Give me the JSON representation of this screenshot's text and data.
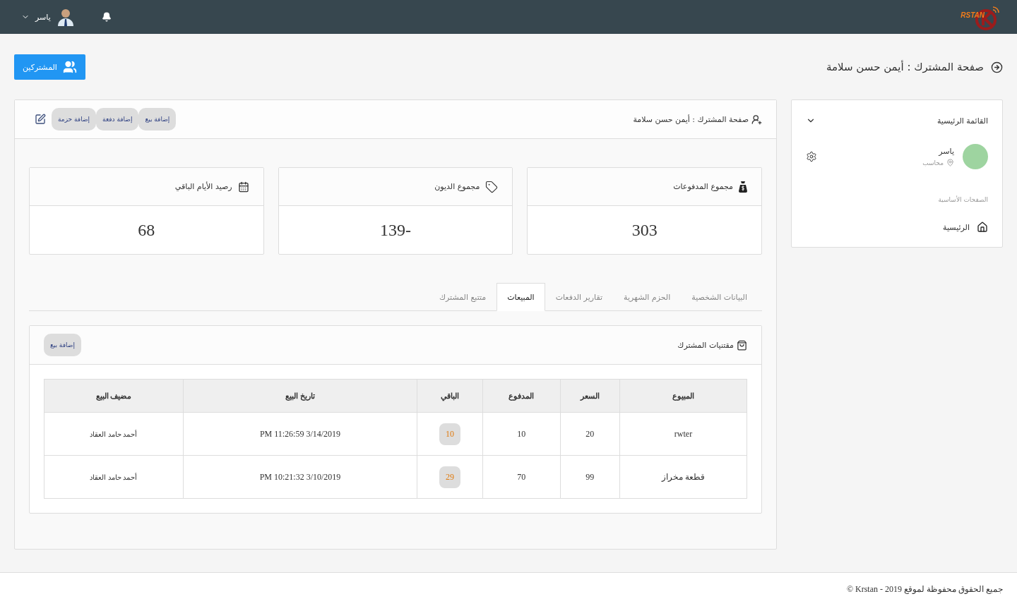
{
  "topbar": {
    "logo_text": "RSTAN",
    "user_name": "ياسر"
  },
  "page": {
    "title": "صفحة المشترك : أيمن حسن سلامة",
    "subscribers_button": "المشتركين"
  },
  "sidebar": {
    "title": "القائمة الرئيسية",
    "user": {
      "name": "ياسر",
      "role": "محاسب"
    },
    "section_label": "الصفحات الأساسية",
    "items": [
      {
        "label": "الرئيسية"
      }
    ]
  },
  "card": {
    "title": "صفحة المشترك : أيمن حسن سلامة",
    "actions": [
      "إضافة بيع",
      "إضافة دفعة",
      "إضافة حزمة"
    ]
  },
  "stats": [
    {
      "kind": "payments",
      "label": "مجموع المدفوعات",
      "value": "303"
    },
    {
      "kind": "debts",
      "label": "مجموع الديون",
      "value": "-139"
    },
    {
      "kind": "days",
      "label": "رصيد الأيام الباقي",
      "value": "68"
    }
  ],
  "tabs": [
    {
      "label": "البيانات الشخصية",
      "selected": false
    },
    {
      "label": "الحزم الشهرية",
      "selected": false
    },
    {
      "label": "تقارير الدفعات",
      "selected": false
    },
    {
      "label": "المبيعات",
      "selected": true
    },
    {
      "label": "متتبع المشترك",
      "selected": false
    }
  ],
  "sales": {
    "title": "مقتنيات المشترك",
    "add_button": "إضافة بيع",
    "columns": [
      "المبيوع",
      "السعر",
      "المدفوع",
      "الباقي",
      "تاريخ البيع",
      "مضيف البيع"
    ],
    "rows": [
      {
        "item": "rwter",
        "price": "20",
        "paid": "10",
        "remaining": "10",
        "date": "3/14/2019 11:26:59 PM",
        "added_by": "أحمد حامد العقاد"
      },
      {
        "item": "قطعة مخراز",
        "price": "99",
        "paid": "70",
        "remaining": "29",
        "date": "3/10/2019 10:21:32 PM",
        "added_by": "أحمد حامد العقاد"
      }
    ]
  },
  "footer": {
    "text": "جميع الحقوق محفوظة لموقع 2019 - Krstan ©"
  }
}
